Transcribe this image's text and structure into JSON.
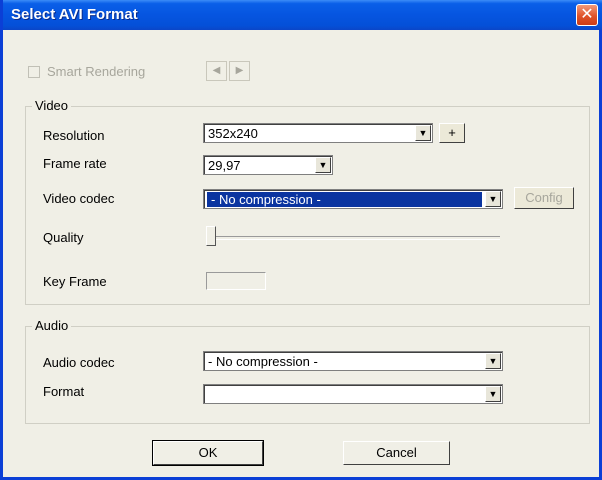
{
  "window": {
    "title": "Select AVI Format",
    "close_glyph": "✕"
  },
  "smart_rendering": {
    "label": "Smart Rendering",
    "checked": false,
    "enabled": false
  },
  "nav_arrows": {
    "prev_glyph": "◀",
    "next_glyph": "▶"
  },
  "video": {
    "group_label": "Video",
    "resolution_label": "Resolution",
    "resolution_value": "352x240",
    "add_button": "+",
    "frame_rate_label": "Frame rate",
    "frame_rate_value": "29,97",
    "codec_label": "Video codec",
    "codec_value": "- No compression -",
    "config_button": "Config",
    "quality_label": "Quality",
    "quality_level": 0,
    "key_frame_label": "Key Frame",
    "key_frame_value": ""
  },
  "audio": {
    "group_label": "Audio",
    "codec_label": "Audio codec",
    "codec_value": "- No compression -",
    "format_label": "Format",
    "format_value": ""
  },
  "buttons": {
    "ok": "OK",
    "cancel": "Cancel"
  },
  "dropdown_glyph": "▼",
  "colors": {
    "titlebar": "#0655e0",
    "selection": "#0a34a0",
    "dialog_bg": "#f0efe6"
  }
}
